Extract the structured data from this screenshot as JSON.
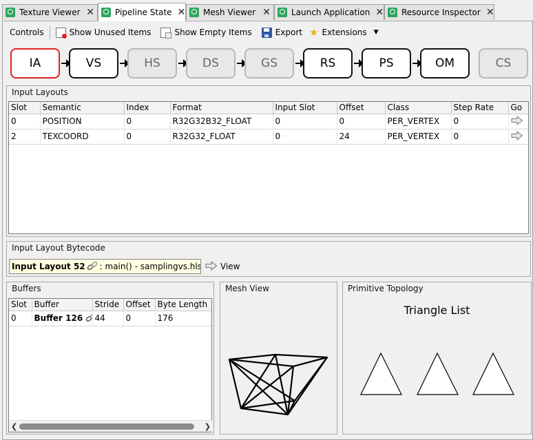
{
  "tabs": [
    {
      "label": "Texture Viewer",
      "close": "✕"
    },
    {
      "label": "Pipeline State",
      "close": "✕"
    },
    {
      "label": "Mesh Viewer",
      "close": "✕"
    },
    {
      "label": "Launch Application",
      "close": "✕"
    },
    {
      "label": "Resource Inspector",
      "close": "✕"
    }
  ],
  "toolbar": {
    "controls": "Controls",
    "show_unused": "Show Unused Items",
    "show_empty": "Show Empty Items",
    "export": "Export",
    "extensions": "Extensions",
    "dropdown_arrow": "▼"
  },
  "pipeline": {
    "stages": [
      "IA",
      "VS",
      "HS",
      "DS",
      "GS",
      "RS",
      "PS",
      "OM",
      "CS"
    ],
    "selected": "IA",
    "disabled": [
      "HS",
      "DS",
      "GS",
      "CS"
    ]
  },
  "input_layouts": {
    "title": "Input Layouts",
    "columns": [
      "Slot",
      "Semantic",
      "Index",
      "Format",
      "Input Slot",
      "Offset",
      "Class",
      "Step Rate",
      "Go"
    ],
    "rows": [
      [
        "0",
        "POSITION",
        "0",
        "R32G32B32_FLOAT",
        "0",
        "0",
        "PER_VERTEX",
        "0"
      ],
      [
        "2",
        "TEXCOORD",
        "0",
        "R32G32_FLOAT",
        "0",
        "24",
        "PER_VERTEX",
        "0"
      ]
    ]
  },
  "bytecode": {
    "title": "Input Layout Bytecode",
    "label": "Input Layout 52",
    "detail": " : main() - samplingvs.hlsl",
    "view": "View"
  },
  "buffers": {
    "title": "Buffers",
    "columns": [
      "Slot",
      "Buffer",
      "Stride",
      "Offset",
      "Byte Length"
    ],
    "rows": [
      [
        "0",
        "Buffer 126",
        "44",
        "0",
        "176"
      ]
    ],
    "scroll_left": "❮",
    "scroll_right": "❯"
  },
  "mesh_view": {
    "title": "Mesh View"
  },
  "topology": {
    "title": "Primitive Topology",
    "value": "Triangle List"
  },
  "colors": {
    "accent_green": "#2ca65c",
    "selected_stage": "#e02020",
    "tooltip_bg": "#ffffe0"
  }
}
